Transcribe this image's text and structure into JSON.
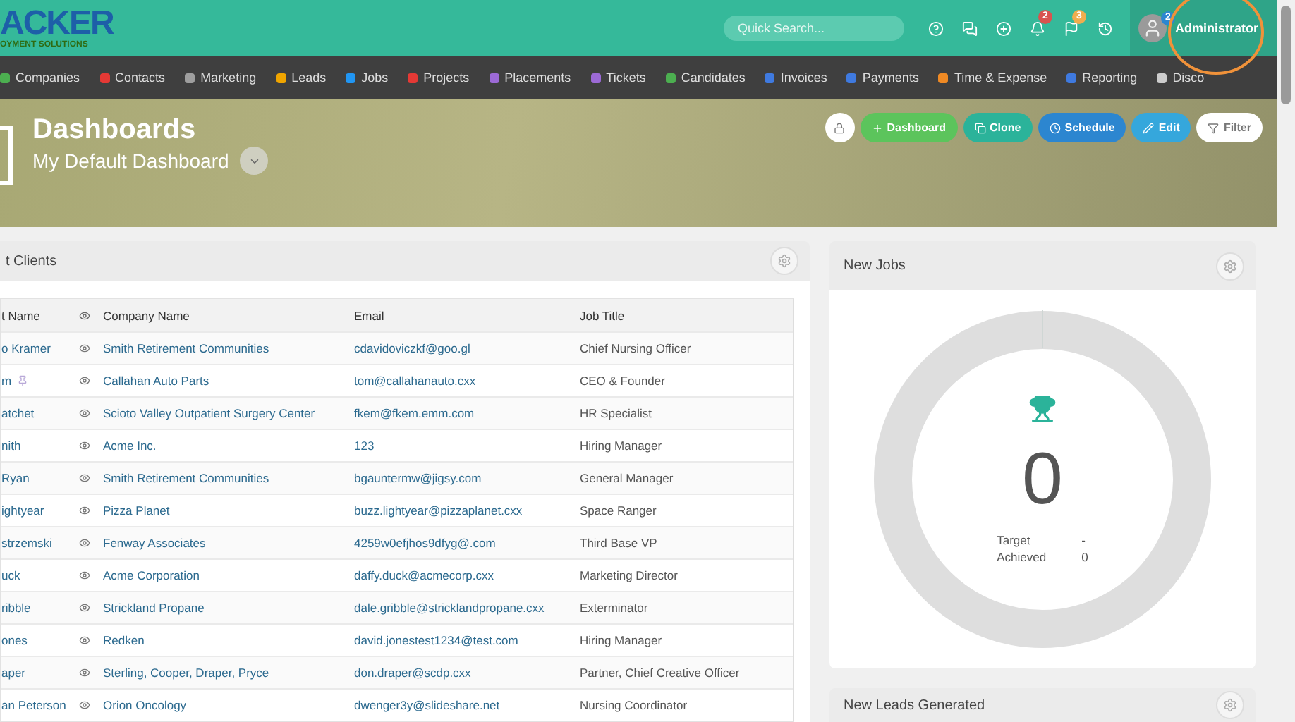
{
  "logo": {
    "name": "ACKER",
    "tagline": "OYMENT SOLUTIONS"
  },
  "topbar": {
    "search": {
      "placeholder": "Quick Search..."
    },
    "icons": [
      {
        "kind": "help"
      },
      {
        "kind": "chat"
      },
      {
        "kind": "add"
      },
      {
        "kind": "bell",
        "badge": "2",
        "color": "#d9534f"
      },
      {
        "kind": "flag",
        "badge": "3",
        "color": "#f0ad4e"
      },
      {
        "kind": "history"
      }
    ],
    "user": {
      "badge": "2",
      "name": "Administrator"
    }
  },
  "nav": [
    {
      "label": "Companies",
      "color": "#4caf50"
    },
    {
      "label": "Contacts",
      "color": "#e53935"
    },
    {
      "label": "Marketing",
      "color": "#9e9e9e"
    },
    {
      "label": "Leads",
      "color": "#f0a500"
    },
    {
      "label": "Jobs",
      "color": "#2196f3"
    },
    {
      "label": "Projects",
      "color": "#e53935"
    },
    {
      "label": "Placements",
      "color": "#9c6ad6"
    },
    {
      "label": "Tickets",
      "color": "#9c6ad6"
    },
    {
      "label": "Candidates",
      "color": "#4caf50"
    },
    {
      "label": "Invoices",
      "color": "#3f7ae0"
    },
    {
      "label": "Payments",
      "color": "#3f7ae0"
    },
    {
      "label": "Time & Expense",
      "color": "#f08a24"
    },
    {
      "label": "Reporting",
      "color": "#3f7ae0"
    },
    {
      "label": "Disco",
      "color": "#cccccc"
    }
  ],
  "hero": {
    "title": "Dashboards",
    "subtitle": "My Default Dashboard",
    "buttons": [
      {
        "kind": "lock"
      },
      {
        "kind": "add",
        "label": "Dashboard"
      },
      {
        "kind": "clone",
        "label": "Clone"
      },
      {
        "kind": "schedule",
        "label": "Schedule"
      },
      {
        "kind": "edit",
        "label": "Edit"
      },
      {
        "kind": "filter",
        "label": "Filter"
      }
    ]
  },
  "clients_panel": {
    "title": "t Clients",
    "columns": [
      "t Name",
      "Company Name",
      "Email",
      "Job Title"
    ],
    "rows": [
      {
        "name": "o Kramer",
        "pinned": false,
        "company": "Smith Retirement Communities",
        "email": "cdavidoviczkf@goo.gl",
        "job": "Chief Nursing Officer"
      },
      {
        "name": "m",
        "pinned": true,
        "company": "Callahan Auto Parts",
        "email": "tom@callahanauto.cxx",
        "job": "CEO & Founder"
      },
      {
        "name": "atchet",
        "pinned": false,
        "company": "Scioto Valley Outpatient Surgery Center",
        "email": "fkem@fkem.emm.com",
        "job": "HR Specialist"
      },
      {
        "name": "nith",
        "pinned": false,
        "company": "Acme Inc.",
        "email": "123",
        "job": "Hiring Manager"
      },
      {
        "name": "Ryan",
        "pinned": false,
        "company": "Smith Retirement Communities",
        "email": "bgauntermw@jigsy.com",
        "job": "General Manager"
      },
      {
        "name": "ightyear",
        "pinned": false,
        "company": "Pizza Planet",
        "email": "buzz.lightyear@pizzaplanet.cxx",
        "job": "Space Ranger"
      },
      {
        "name": "strzemski",
        "pinned": false,
        "company": "Fenway Associates",
        "email": "4259w0efjhos9dfyg@.com",
        "job": "Third Base VP"
      },
      {
        "name": "uck",
        "pinned": false,
        "company": "Acme Corporation",
        "email": "daffy.duck@acmecorp.cxx",
        "job": "Marketing Director"
      },
      {
        "name": "ribble",
        "pinned": false,
        "company": "Strickland Propane",
        "email": "dale.gribble@stricklandpropane.cxx",
        "job": "Exterminator"
      },
      {
        "name": "ones",
        "pinned": false,
        "company": "Redken",
        "email": "david.jonestest1234@test.com",
        "job": "Hiring Manager"
      },
      {
        "name": "aper",
        "pinned": false,
        "company": "Sterling, Cooper, Draper, Pryce",
        "email": "don.draper@scdp.cxx",
        "job": "Partner, Chief Creative Officer"
      },
      {
        "name": "an Peterson",
        "pinned": false,
        "company": "Orion Oncology",
        "email": "dwenger3y@slideshare.net",
        "job": "Nursing Coordinator"
      }
    ]
  },
  "jobs_panel": {
    "title": "New Jobs",
    "value": "0",
    "target_label": "Target",
    "target": "-",
    "achieved_label": "Achieved",
    "achieved": "0"
  },
  "leads_panel": {
    "title": "New Leads Generated"
  }
}
